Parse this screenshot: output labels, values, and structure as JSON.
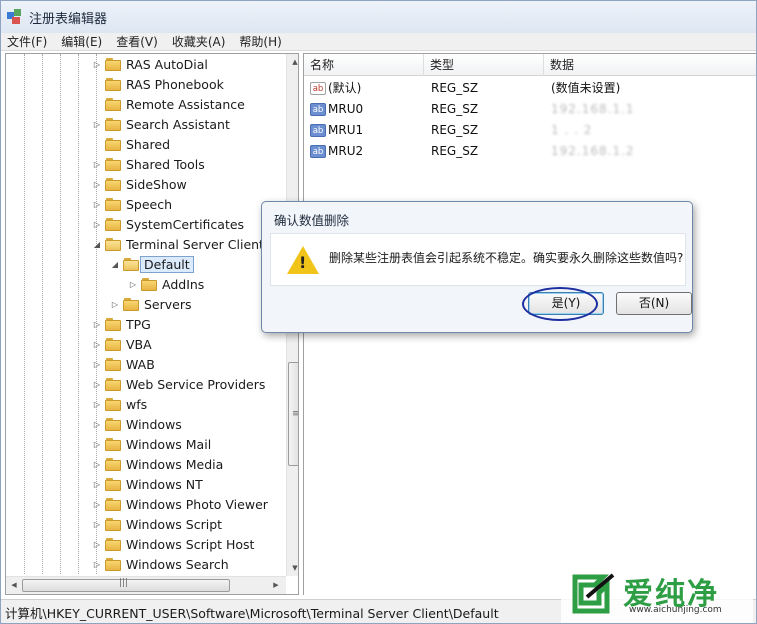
{
  "window": {
    "title": "注册表编辑器"
  },
  "menu": [
    "文件(F)",
    "编辑(E)",
    "查看(V)",
    "收藏夹(A)",
    "帮助(H)"
  ],
  "tree": {
    "items": [
      {
        "label": "RAS AutoDial",
        "state": "collapsed"
      },
      {
        "label": "RAS Phonebook",
        "state": "none"
      },
      {
        "label": "Remote Assistance",
        "state": "none"
      },
      {
        "label": "Search Assistant",
        "state": "collapsed"
      },
      {
        "label": "Shared",
        "state": "none"
      },
      {
        "label": "Shared Tools",
        "state": "collapsed"
      },
      {
        "label": "SideShow",
        "state": "collapsed"
      },
      {
        "label": "Speech",
        "state": "collapsed"
      },
      {
        "label": "SystemCertificates",
        "state": "collapsed"
      },
      {
        "label": "Terminal Server Client",
        "state": "expanded"
      },
      {
        "label": "Default",
        "state": "expanded",
        "selected": true
      },
      {
        "label": "AddIns",
        "state": "collapsed"
      },
      {
        "label": "Servers",
        "state": "collapsed"
      },
      {
        "label": "TPG",
        "state": "collapsed"
      },
      {
        "label": "VBA",
        "state": "collapsed"
      },
      {
        "label": "WAB",
        "state": "collapsed"
      },
      {
        "label": "Web Service Providers",
        "state": "collapsed"
      },
      {
        "label": "wfs",
        "state": "collapsed"
      },
      {
        "label": "Windows",
        "state": "collapsed"
      },
      {
        "label": "Windows Mail",
        "state": "collapsed"
      },
      {
        "label": "Windows Media",
        "state": "collapsed"
      },
      {
        "label": "Windows NT",
        "state": "collapsed"
      },
      {
        "label": "Windows Photo Viewer",
        "state": "collapsed"
      },
      {
        "label": "Windows Script",
        "state": "collapsed"
      },
      {
        "label": "Windows Script Host",
        "state": "collapsed"
      },
      {
        "label": "Windows Search",
        "state": "collapsed"
      }
    ]
  },
  "values": {
    "columns": [
      "名称",
      "类型",
      "数据"
    ],
    "rows": [
      {
        "name": "(默认)",
        "type": "REG_SZ",
        "data": "(数值未设置)",
        "icon": "ab-default-icon"
      },
      {
        "name": "MRU0",
        "type": "REG_SZ",
        "data": "192.168.1.1",
        "icon": "ab-string-icon",
        "obscured": true
      },
      {
        "name": "MRU1",
        "type": "REG_SZ",
        "data": "1  .  .  2",
        "icon": "ab-string-icon",
        "obscured": true
      },
      {
        "name": "MRU2",
        "type": "REG_SZ",
        "data": "192.168.1.2",
        "icon": "ab-string-icon",
        "obscured": true
      }
    ]
  },
  "dialog": {
    "title": "确认数值删除",
    "message": "删除某些注册表值会引起系统不稳定。确实要永久删除这些数值吗?",
    "yes_label": "是(Y)",
    "no_label": "否(N)",
    "icon": "warning-icon",
    "highlight_color": "#1d2fa0"
  },
  "status": {
    "path": "计算机\\HKEY_CURRENT_USER\\Software\\Microsoft\\Terminal Server Client\\Default"
  },
  "watermark": {
    "brand": "爱纯净",
    "url": "www.aichunjing.com",
    "color": "#2e9e45"
  }
}
